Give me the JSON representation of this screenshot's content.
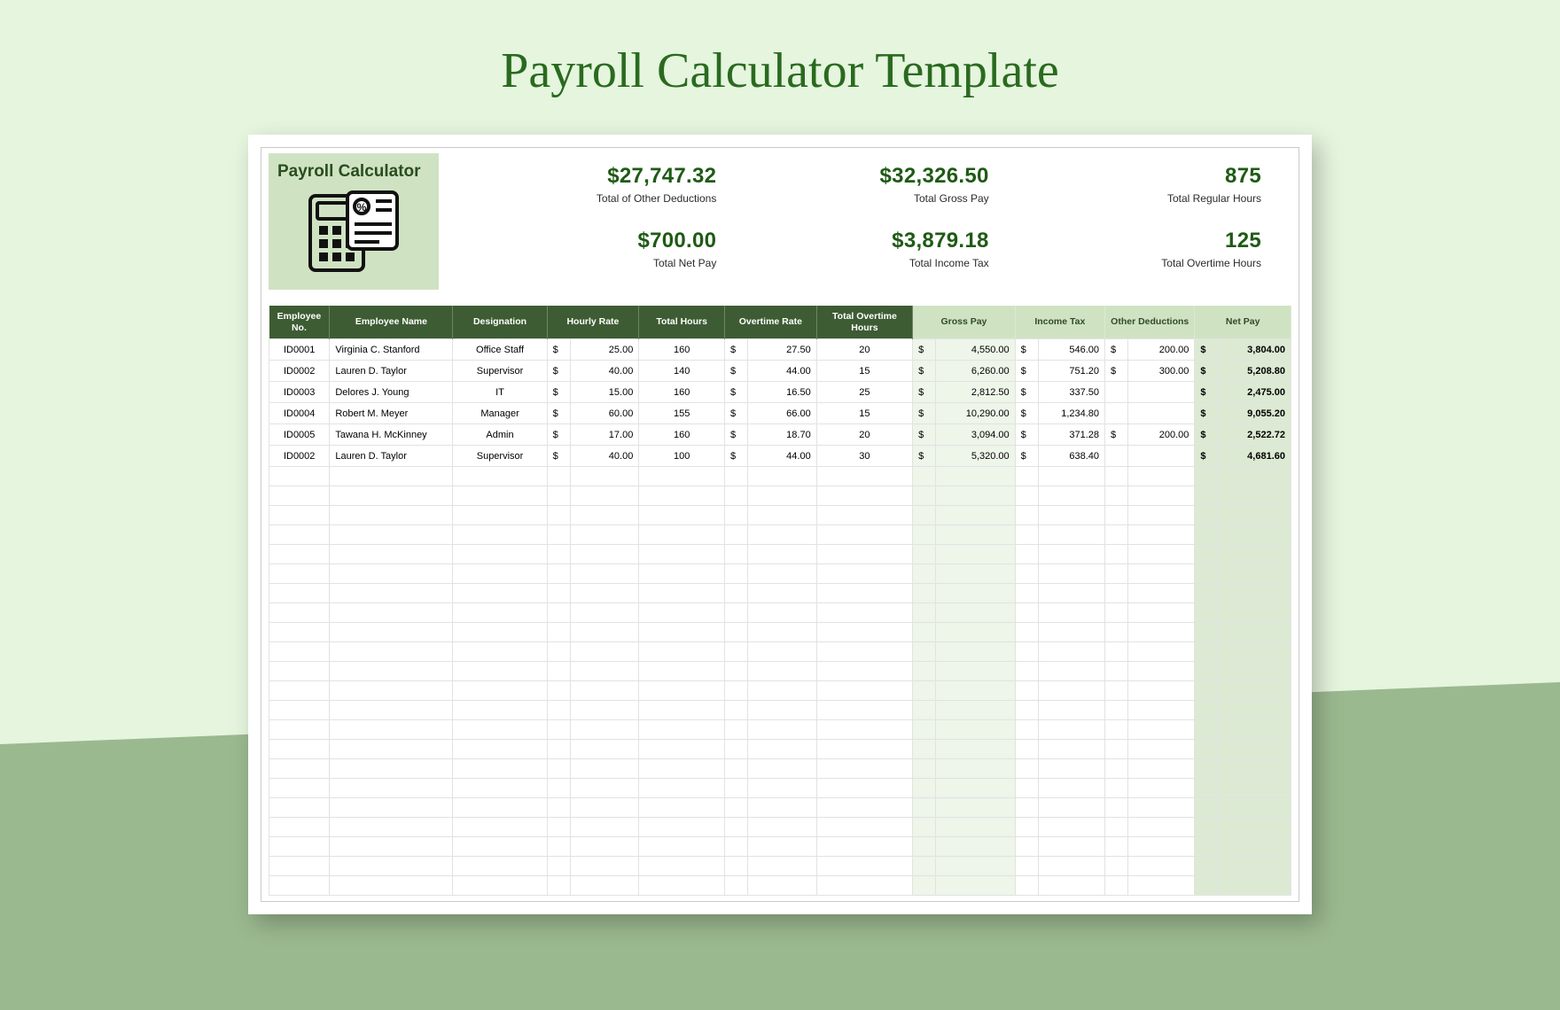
{
  "page": {
    "title": "Payroll Calculator Template"
  },
  "logo": {
    "title": "Payroll Calculator"
  },
  "stats": {
    "other_deductions": {
      "value": "$27,747.32",
      "label": "Total of Other Deductions"
    },
    "gross_pay": {
      "value": "$32,326.50",
      "label": "Total Gross Pay"
    },
    "regular_hours": {
      "value": "875",
      "label": "Total Regular Hours"
    },
    "net_pay": {
      "value": "$700.00",
      "label": "Total Net Pay"
    },
    "income_tax": {
      "value": "$3,879.18",
      "label": "Total Income Tax"
    },
    "overtime_hours": {
      "value": "125",
      "label": "Total Overtime Hours"
    }
  },
  "table": {
    "headers": {
      "emp_no": "Employee No.",
      "emp_name": "Employee Name",
      "designation": "Designation",
      "hourly_rate": "Hourly Rate",
      "total_hours": "Total Hours",
      "overtime_rate": "Overtime Rate",
      "total_ot_hours": "Total Overtime Hours",
      "gross_pay": "Gross Pay",
      "income_tax": "Income Tax",
      "other_deductions": "Other Deductions",
      "net_pay": "Net Pay"
    },
    "currency": "$",
    "rows": [
      {
        "id": "ID0001",
        "name": "Virginia C. Stanford",
        "desg": "Office Staff",
        "hr": "25.00",
        "th": "160",
        "or": "27.50",
        "oth": "20",
        "gp": "4,550.00",
        "it": "546.00",
        "od": "200.00",
        "np": "3,804.00"
      },
      {
        "id": "ID0002",
        "name": "Lauren D. Taylor",
        "desg": "Supervisor",
        "hr": "40.00",
        "th": "140",
        "or": "44.00",
        "oth": "15",
        "gp": "6,260.00",
        "it": "751.20",
        "od": "300.00",
        "np": "5,208.80"
      },
      {
        "id": "ID0003",
        "name": "Delores J. Young",
        "desg": "IT",
        "hr": "15.00",
        "th": "160",
        "or": "16.50",
        "oth": "25",
        "gp": "2,812.50",
        "it": "337.50",
        "od": "",
        "np": "2,475.00"
      },
      {
        "id": "ID0004",
        "name": "Robert M. Meyer",
        "desg": "Manager",
        "hr": "60.00",
        "th": "155",
        "or": "66.00",
        "oth": "15",
        "gp": "10,290.00",
        "it": "1,234.80",
        "od": "",
        "np": "9,055.20"
      },
      {
        "id": "ID0005",
        "name": "Tawana H. McKinney",
        "desg": "Admin",
        "hr": "17.00",
        "th": "160",
        "or": "18.70",
        "oth": "20",
        "gp": "3,094.00",
        "it": "371.28",
        "od": "200.00",
        "np": "2,522.72"
      },
      {
        "id": "ID0002",
        "name": "Lauren D. Taylor",
        "desg": "Supervisor",
        "hr": "40.00",
        "th": "100",
        "or": "44.00",
        "oth": "30",
        "gp": "5,320.00",
        "it": "638.40",
        "od": "",
        "np": "4,681.60"
      }
    ],
    "empty_rows": 22
  }
}
